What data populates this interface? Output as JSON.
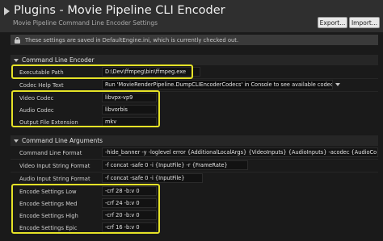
{
  "header": {
    "title": "Plugins - Movie Pipeline CLI Encoder",
    "subtitle": "Movie Pipeline Command Line Encoder Settings",
    "export_label": "Export...",
    "import_label": "Import..."
  },
  "notice": {
    "text": "These settings are saved in DefaultEngine.ini, which is currently checked out."
  },
  "sections": {
    "command_line_encoder": {
      "label": "Command Line Encoder",
      "rows": [
        {
          "label": "Executable Path",
          "value": "D:\\Dev\\ffmpeg\\bin\\ffmpeg.exe"
        },
        {
          "label": "Codec Help Text",
          "value": "Run 'MovieRenderPipeline.DumpCLIEncoderCodecs' in Console to see available codecs."
        },
        {
          "label": "Video Codec",
          "value": "libvpx-vp9"
        },
        {
          "label": "Audio Codec",
          "value": "libvorbis"
        },
        {
          "label": "Output File Extension",
          "value": "mkv"
        }
      ]
    },
    "command_line_arguments": {
      "label": "Command Line Arguments",
      "rows": [
        {
          "label": "Command Line Format",
          "value": "-hide_banner -y -loglevel error {AdditionalLocalArgs} {VideoInputs} {AudioInputs} -acodec {AudioCo"
        },
        {
          "label": "Video Input String Format",
          "value": "-f concat -safe 0 -i {InputFile} -r {FrameRate}"
        },
        {
          "label": "Audio Input String Format",
          "value": "-f concat -safe 0 -i {InputFile}"
        },
        {
          "label": "Encode Settings Low",
          "value": "-crf 28 -b:v 0"
        },
        {
          "label": "Encode Settings Med",
          "value": "-crf 24 -b:v 0"
        },
        {
          "label": "Encode Settings High",
          "value": "-crf 20 -b:v 0"
        },
        {
          "label": "Encode Settings Epic",
          "value": "-crf 16 -b:v 0"
        }
      ]
    }
  },
  "colors": {
    "highlight": "#e5e227",
    "background": "#1a1a1a",
    "header": "#2f2f2f"
  },
  "icons": {
    "title_arrow": "collapse-arrow-icon",
    "notice": "lock-icon",
    "section_toggle": "chevron-down-icon",
    "dropdown": "dropdown-arrow-icon"
  }
}
